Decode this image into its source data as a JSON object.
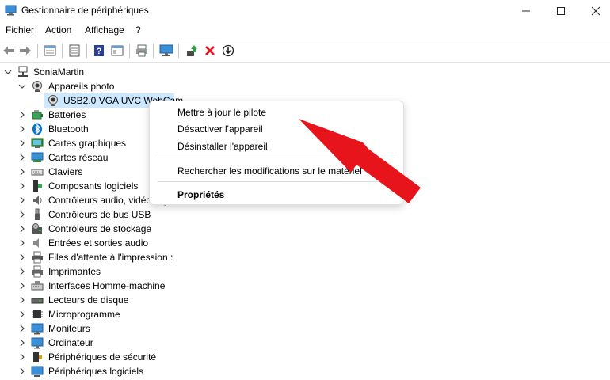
{
  "window": {
    "title": "Gestionnaire de périphériques",
    "controls": {
      "minimize": "—",
      "maximize": "☐",
      "close": "✕"
    }
  },
  "menu": [
    "Fichier",
    "Action",
    "Affichage",
    "?"
  ],
  "toolbar_icons": [
    "back-arrow-icon",
    "forward-arrow-icon",
    "properties-icon",
    "list-icon",
    "help-icon",
    "details-icon",
    "print-icon",
    "monitor-icon",
    "update-driver-icon",
    "remove-icon",
    "download-icon"
  ],
  "tree": {
    "root": "SoniaMartin",
    "items": [
      {
        "label": "Appareils photo",
        "expanded": true,
        "icon": "camera-icon",
        "children": [
          {
            "label": "USB2.0 VGA UVC WebCam",
            "icon": "webcam-icon",
            "selected": true
          }
        ]
      },
      {
        "label": "Batteries",
        "icon": "battery-icon"
      },
      {
        "label": "Bluetooth",
        "icon": "bluetooth-icon"
      },
      {
        "label": "Cartes graphiques",
        "icon": "display-adapter-icon"
      },
      {
        "label": "Cartes réseau",
        "icon": "network-icon"
      },
      {
        "label": "Claviers",
        "icon": "keyboard-icon"
      },
      {
        "label": "Composants logiciels",
        "icon": "software-component-icon"
      },
      {
        "label": "Contrôleurs audio, vidéo et jeu",
        "icon": "audio-controller-icon"
      },
      {
        "label": "Contrôleurs de bus USB",
        "icon": "usb-icon"
      },
      {
        "label": "Contrôleurs de stockage",
        "icon": "storage-controller-icon"
      },
      {
        "label": "Entrées et sorties audio",
        "icon": "audio-io-icon"
      },
      {
        "label": "Files d'attente à l'impression :",
        "icon": "print-queue-icon"
      },
      {
        "label": "Imprimantes",
        "icon": "printer-icon"
      },
      {
        "label": "Interfaces Homme-machine",
        "icon": "hid-icon"
      },
      {
        "label": "Lecteurs de disque",
        "icon": "disk-icon"
      },
      {
        "label": "Microprogramme",
        "icon": "firmware-icon"
      },
      {
        "label": "Moniteurs",
        "icon": "monitor-icon"
      },
      {
        "label": "Ordinateur",
        "icon": "computer-icon"
      },
      {
        "label": "Périphériques de sécurité",
        "icon": "security-device-icon"
      },
      {
        "label": "Périphériques logiciels",
        "icon": "software-device-icon"
      }
    ]
  },
  "context_menu": {
    "items": [
      "Mettre à jour le pilote",
      "Désactiver l'appareil",
      "Désinstaller l'appareil",
      "Rechercher les modifications sur le matériel",
      "Propriétés"
    ]
  },
  "colors": {
    "selection": "#cce8ff",
    "arrow": "#e8141b",
    "accent": "#0067c0"
  }
}
